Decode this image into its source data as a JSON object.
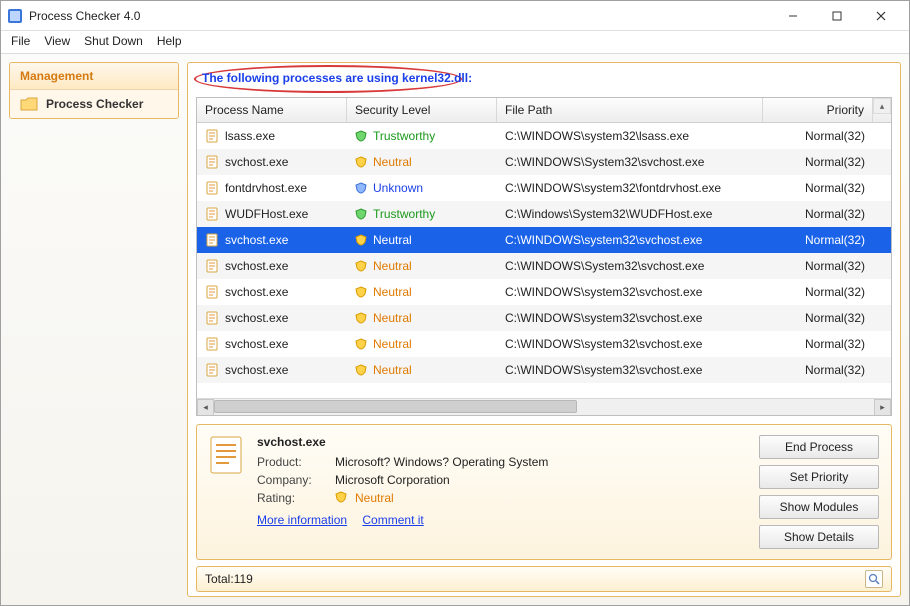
{
  "window": {
    "title": "Process Checker 4.0"
  },
  "menu": {
    "items": [
      "File",
      "View",
      "Shut Down",
      "Help"
    ]
  },
  "sidebar": {
    "header": "Management",
    "item": "Process Checker"
  },
  "notice": "The following processes are using kernel32.dll:",
  "columns": {
    "name": "Process Name",
    "security": "Security Level",
    "path": "File Path",
    "priority": "Priority"
  },
  "rows": [
    {
      "name": "lsass.exe",
      "sec": "Trustworthy",
      "path": "C:\\WINDOWS\\system32\\lsass.exe",
      "prio": "Normal(32)",
      "selected": false
    },
    {
      "name": "svchost.exe",
      "sec": "Neutral",
      "path": "C:\\WINDOWS\\System32\\svchost.exe",
      "prio": "Normal(32)",
      "selected": false
    },
    {
      "name": "fontdrvhost.exe",
      "sec": "Unknown",
      "path": "C:\\WINDOWS\\system32\\fontdrvhost.exe",
      "prio": "Normal(32)",
      "selected": false
    },
    {
      "name": "WUDFHost.exe",
      "sec": "Trustworthy",
      "path": "C:\\Windows\\System32\\WUDFHost.exe",
      "prio": "Normal(32)",
      "selected": false
    },
    {
      "name": "svchost.exe",
      "sec": "Neutral",
      "path": "C:\\WINDOWS\\system32\\svchost.exe",
      "prio": "Normal(32)",
      "selected": true
    },
    {
      "name": "svchost.exe",
      "sec": "Neutral",
      "path": "C:\\WINDOWS\\System32\\svchost.exe",
      "prio": "Normal(32)",
      "selected": false
    },
    {
      "name": "svchost.exe",
      "sec": "Neutral",
      "path": "C:\\WINDOWS\\system32\\svchost.exe",
      "prio": "Normal(32)",
      "selected": false
    },
    {
      "name": "svchost.exe",
      "sec": "Neutral",
      "path": "C:\\WINDOWS\\system32\\svchost.exe",
      "prio": "Normal(32)",
      "selected": false
    },
    {
      "name": "svchost.exe",
      "sec": "Neutral",
      "path": "C:\\WINDOWS\\system32\\svchost.exe",
      "prio": "Normal(32)",
      "selected": false
    },
    {
      "name": "svchost.exe",
      "sec": "Neutral",
      "path": "C:\\WINDOWS\\system32\\svchost.exe",
      "prio": "Normal(32)",
      "selected": false
    }
  ],
  "detail": {
    "title": "svchost.exe",
    "labels": {
      "product": "Product:",
      "company": "Company:",
      "rating": "Rating:"
    },
    "product": "Microsoft? Windows? Operating System",
    "company": "Microsoft Corporation",
    "rating": "Neutral",
    "links": {
      "more": "More information",
      "comment": "Comment it"
    },
    "actions": {
      "end": "End Process",
      "priority": "Set Priority",
      "modules": "Show Modules",
      "details": "Show Details"
    }
  },
  "status": {
    "total_label": "Total: ",
    "total_value": "119"
  }
}
